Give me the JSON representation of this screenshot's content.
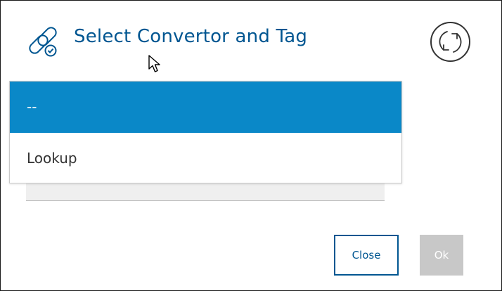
{
  "dialog": {
    "title": "Select Convertor and Tag",
    "title_icon": "link-icon",
    "refresh_icon": "refresh-icon",
    "accent_color": "#005691",
    "selection_color": "#0a88c8"
  },
  "dropdown": {
    "options": [
      {
        "label": "--",
        "selected": true
      },
      {
        "label": "Lookup",
        "selected": false
      }
    ]
  },
  "buttons": {
    "close_label": "Close",
    "ok_label": "Ok",
    "ok_disabled": true
  }
}
